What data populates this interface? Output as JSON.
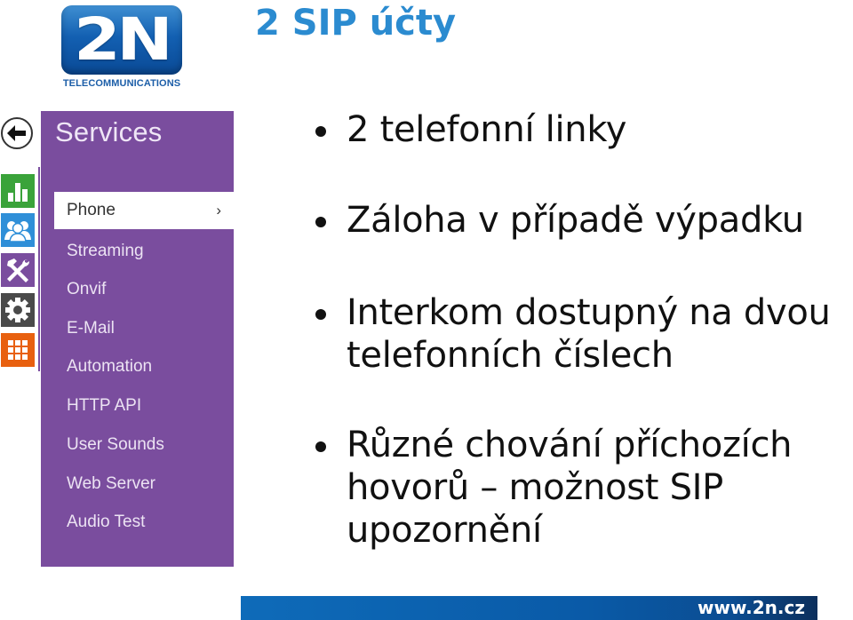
{
  "logo": {
    "mark": "2N",
    "subtitle": "TELECOMMUNICATIONS"
  },
  "slide": {
    "title": "2 SIP účty"
  },
  "rail": {
    "back_icon": "arrow-left-icon",
    "icons": [
      {
        "name": "status-icon",
        "color": "#3aa33a"
      },
      {
        "name": "directory-icon",
        "color": "#2f8fd8"
      },
      {
        "name": "hardware-icon",
        "color": "#7a4d9e"
      },
      {
        "name": "system-icon",
        "color": "#4a4a4a"
      },
      {
        "name": "services-grid-icon",
        "color": "#e8600f"
      }
    ]
  },
  "services": {
    "title": "Services",
    "items": [
      {
        "label": "Phone",
        "active": true,
        "chevron": "›"
      },
      {
        "label": "Streaming"
      },
      {
        "label": "Onvif"
      },
      {
        "label": "E-Mail"
      },
      {
        "label": "Automation"
      },
      {
        "label": "HTTP API"
      },
      {
        "label": "User Sounds"
      },
      {
        "label": "Web Server"
      },
      {
        "label": "Audio Test"
      }
    ]
  },
  "bullets": [
    "2 telefonní linky",
    "Záloha v případě výpadku",
    "Interkom dostupný na dvou\ntelefonních číslech",
    "Různé chování příchozích\nhovorů – možnost SIP\nupozornění"
  ],
  "footer": {
    "url": "www.2n.cz"
  },
  "colors": {
    "title": "#2b8bd0",
    "panel": "#7a4d9e",
    "footer": "#0a5aa7"
  }
}
